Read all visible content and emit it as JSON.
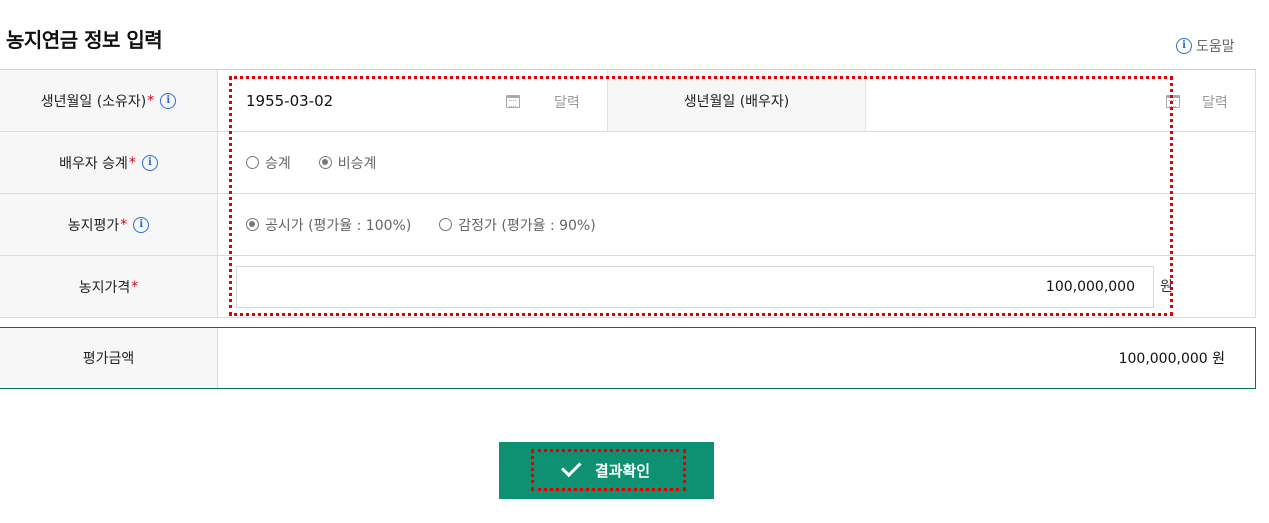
{
  "page": {
    "title": "농지연금 정보 입력",
    "help_label": "도움말"
  },
  "form": {
    "owner_birth": {
      "label": "생년월일 (소유자)",
      "required_mark": "*",
      "value": "1955-03-02",
      "calendar_label": "달력"
    },
    "spouse_birth": {
      "label": "생년월일 (배우자)",
      "value": "",
      "calendar_label": "달력"
    },
    "spouse_succession": {
      "label": "배우자 승계",
      "required_mark": "*",
      "options": [
        "승계",
        "비승계"
      ],
      "selected": "비승계"
    },
    "land_valuation": {
      "label": "농지평가",
      "required_mark": "*",
      "options": [
        "공시가 (평가율 : 100%)",
        "감정가 (평가율 : 90%)"
      ],
      "selected": "공시가 (평가율 : 100%)"
    },
    "land_price": {
      "label": "농지가격",
      "required_mark": "*",
      "value": "100,000,000",
      "unit": "원"
    }
  },
  "result": {
    "label": "평가금액",
    "value": "100,000,000 원"
  },
  "submit": {
    "label": "결과확인"
  },
  "colors": {
    "accent": "#0e9173",
    "required": "#d0021b",
    "info": "#2a6ecf",
    "highlight": "#e00000"
  }
}
